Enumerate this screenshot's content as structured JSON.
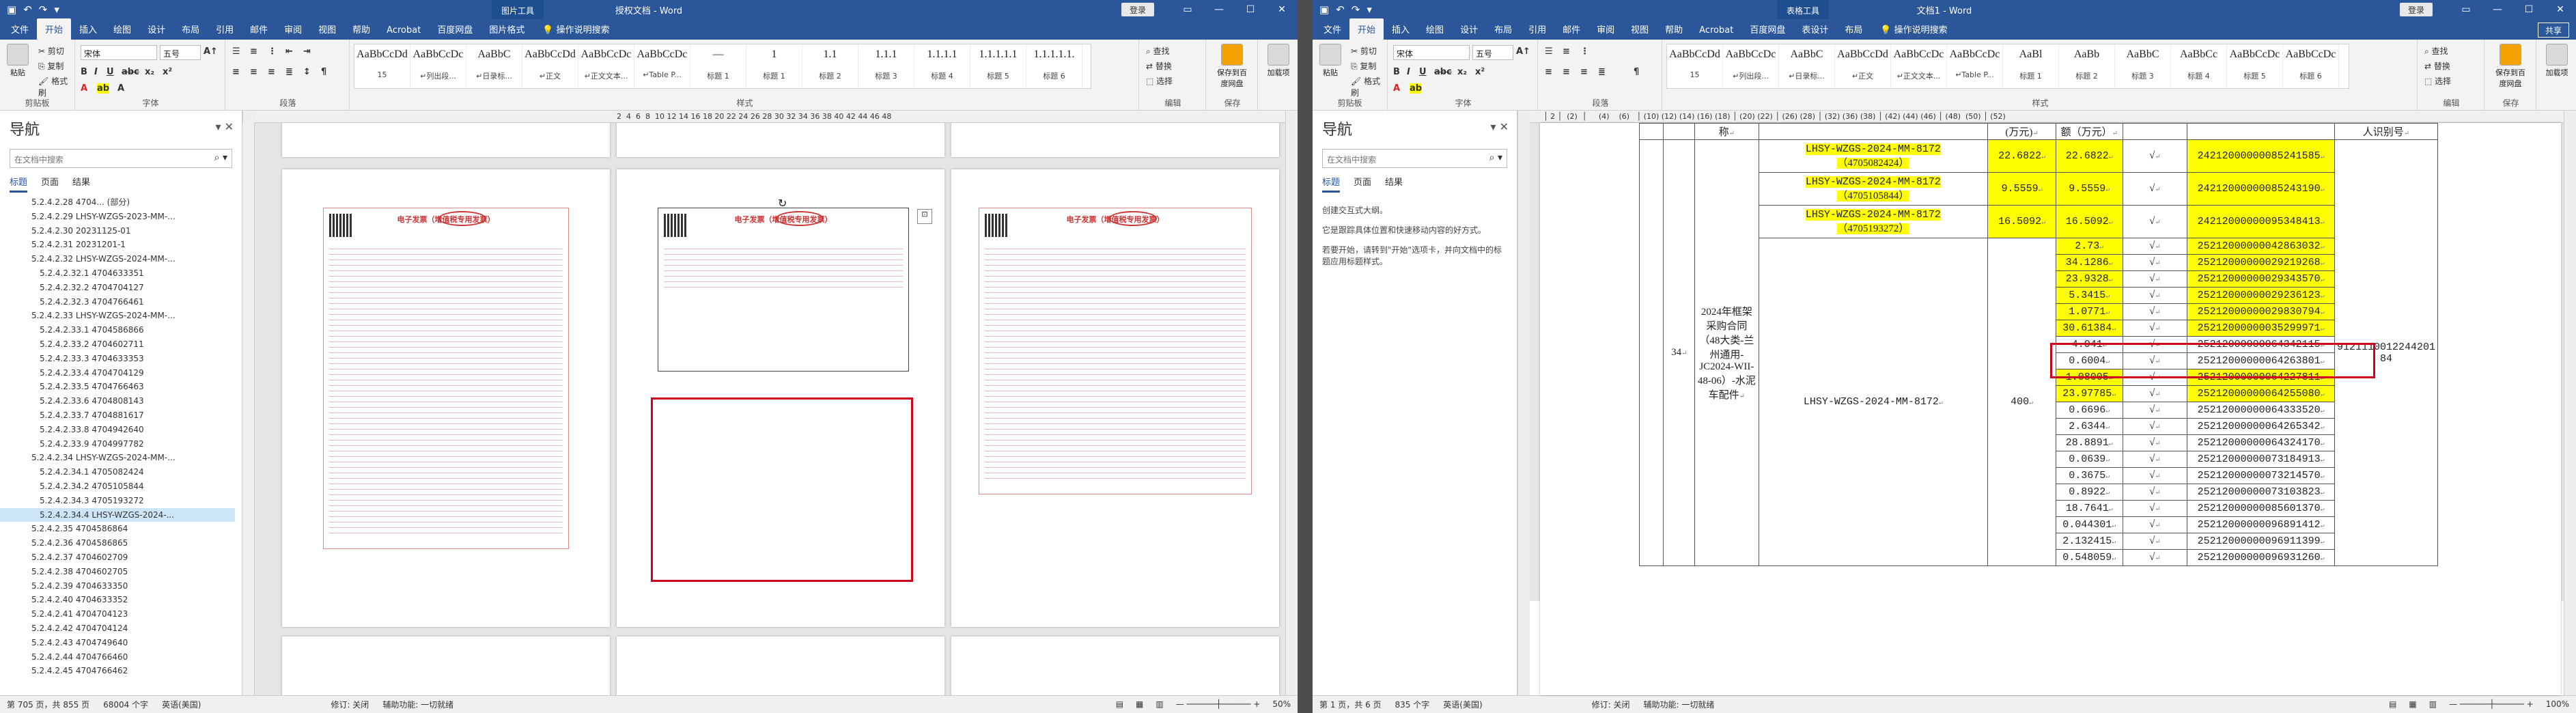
{
  "left_window": {
    "context_label": "图片工具",
    "title": "授权文档 - Word",
    "login": "登录",
    "tabs": [
      "文件",
      "开始",
      "插入",
      "绘图",
      "设计",
      "布局",
      "引用",
      "邮件",
      "审阅",
      "视图",
      "帮助",
      "Acrobat",
      "百度网盘",
      "图片格式"
    ],
    "active_tab": "开始",
    "tell_me": "操作说明搜索",
    "ribbon": {
      "clipboard": {
        "paste": "粘贴",
        "cut": "剪切",
        "copy": "复制",
        "format_painter": "格式刷",
        "label": "剪贴板"
      },
      "font": {
        "name": "宋体",
        "size": "五号",
        "label": "字体"
      },
      "paragraph": {
        "label": "段落"
      },
      "styles": {
        "label": "样式",
        "items": [
          {
            "preview": "AaBbCcDd",
            "name": "15"
          },
          {
            "preview": "AaBbCcDc",
            "name": "↵列出段..."
          },
          {
            "preview": "AaBbC",
            "name": "↵日录标..."
          },
          {
            "preview": "AaBbCcDd",
            "name": "↵正文"
          },
          {
            "preview": "AaBbCcDc",
            "name": "↵正文文本..."
          },
          {
            "preview": "AaBbCcDc",
            "name": "↵Table P..."
          },
          {
            "preview": "—",
            "name": "标题 1"
          },
          {
            "preview": "1",
            "name": "标题 1"
          },
          {
            "preview": "1.1",
            "name": "标题 2"
          },
          {
            "preview": "1.1.1",
            "name": "标题 3"
          },
          {
            "preview": "1.1.1.1",
            "name": "标题 4"
          },
          {
            "preview": "1.1.1.1.1",
            "name": "标题 5"
          },
          {
            "preview": "1.1.1.1.1.",
            "name": "标题 6"
          }
        ]
      },
      "editing": {
        "find": "查找",
        "replace": "替换",
        "select": "选择",
        "label": "编辑"
      },
      "save_baidu": "保存到百度网盘",
      "addins": "加载项",
      "save_group": "保存"
    },
    "nav": {
      "title": "导航",
      "search_placeholder": "在文档中搜索",
      "tabs": [
        "标题",
        "页面",
        "结果"
      ],
      "items": [
        "5.2.4.2.28 4704... (部分)",
        "5.2.4.2.29 LHSY-WZGS-2023-MM-...",
        "5.2.4.2.30 20231125-01",
        "5.2.4.2.31 20231201-1",
        "5.2.4.2.32 LHSY-WZGS-2024-MM-...",
        "5.2.4.2.32.1 4704633351",
        "5.2.4.2.32.2 4704704127",
        "5.2.4.2.32.3 4704766461",
        "5.2.4.2.33 LHSY-WZGS-2024-MM-...",
        "5.2.4.2.33.1 4704586866",
        "5.2.4.2.33.2 4704602711",
        "5.2.4.2.33.3 4704633353",
        "5.2.4.2.33.4 4704704129",
        "5.2.4.2.33.5 4704766463",
        "5.2.4.2.33.6 4704808143",
        "5.2.4.2.33.7 4704881617",
        "5.2.4.2.33.8 4704942640",
        "5.2.4.2.33.9 4704997782",
        "5.2.4.2.34 LHSY-WZGS-2024-MM-...",
        "5.2.4.2.34.1 4705082424",
        "5.2.4.2.34.2 4705105844",
        "5.2.4.2.34.3 4705193272",
        "5.2.4.2.34.4 LHSY-WZGS-2024-...",
        "5.2.4.2.35 4704586864",
        "5.2.4.2.36 4704586865",
        "5.2.4.2.37 4704602709",
        "5.2.4.2.38 4704602705",
        "5.2.4.2.39 4704633350",
        "5.2.4.2.40 4704633352",
        "5.2.4.2.41 4704704123",
        "5.2.4.2.42 4704704124",
        "5.2.4.2.43 4704749640",
        "5.2.4.2.44 4704766460",
        "5.2.4.2.45 4704766462"
      ],
      "selected_index": 22
    },
    "invoice_title": "电子发票（增值税专用发票）",
    "status": {
      "page": "第 705 页，共 855 页",
      "words": "68004 个字",
      "lang": "英语(美国)",
      "track": "修订: 关闭",
      "access": "辅助功能: 一切就绪",
      "zoom": "50%"
    }
  },
  "right_window": {
    "context_label": "表格工具",
    "title": "文档1 - Word",
    "login": "登录",
    "tabs": [
      "文件",
      "开始",
      "插入",
      "绘图",
      "设计",
      "布局",
      "引用",
      "邮件",
      "审阅",
      "视图",
      "帮助",
      "Acrobat",
      "百度网盘",
      "表设计",
      "布局"
    ],
    "active_tab": "开始",
    "tell_me": "操作说明搜索",
    "share": "共享",
    "ribbon": {
      "clipboard": {
        "paste": "粘贴",
        "cut": "剪切",
        "copy": "复制",
        "format_painter": "格式刷",
        "label": "剪贴板"
      },
      "font": {
        "name": "宋体",
        "size": "五号",
        "label": "字体"
      },
      "paragraph": {
        "label": "段落"
      },
      "styles": {
        "label": "样式",
        "items": [
          {
            "preview": "AaBbCcDd",
            "name": "15"
          },
          {
            "preview": "AaBbCcDc",
            "name": "↵列出段..."
          },
          {
            "preview": "AaBbC",
            "name": "↵日录标..."
          },
          {
            "preview": "AaBbCcDd",
            "name": "↵正文"
          },
          {
            "preview": "AaBbCcDc",
            "name": "↵正文文本..."
          },
          {
            "preview": "AaBbCcDc",
            "name": "↵Table P..."
          },
          {
            "preview": "AaBl",
            "name": "标题 1"
          },
          {
            "preview": "AaBb",
            "name": "标题 2"
          },
          {
            "preview": "AaBbC",
            "name": "标题 3"
          },
          {
            "preview": "AaBbCc",
            "name": "标题 4"
          },
          {
            "preview": "AaBbCcDc",
            "name": "标题 5"
          },
          {
            "preview": "AaBbCcDc",
            "name": "标题 6"
          }
        ]
      },
      "editing": {
        "find": "查找",
        "replace": "替换",
        "select": "选择",
        "label": "编辑"
      },
      "save_baidu": "保存到百度网盘",
      "addins": "加载项",
      "save_group": "保存"
    },
    "nav": {
      "title": "导航",
      "search_placeholder": "在文档中搜索",
      "tabs": [
        "标题",
        "页面",
        "结果"
      ],
      "msg1": "创建交互式大纲。",
      "msg2": "它是跟踪具体位置和快速移动内容的好方式。",
      "msg3": "若要开始，请转到\"开始\"选项卡，并向文档中的标题应用标题样式。"
    },
    "table": {
      "header_cells": [
        "称",
        "(万元)",
        "额（万元）",
        "人识别号"
      ],
      "row_no": "34",
      "project": "2024年框架采购合同（48大类-兰州通用-JC2024-WII-48-06）-水泥车配件",
      "contract_top": [
        {
          "code": "LHSY-WZGS-2024-MM-8172",
          "sub": "（4705082424）",
          "amt": "22.6822",
          "tax": "22.6822",
          "inv": "24212000000085241585"
        },
        {
          "code": "LHSY-WZGS-2024-MM-8172",
          "sub": "（4705105844）",
          "amt": "9.5559",
          "tax": "9.5559",
          "inv": "24212000000085243190"
        },
        {
          "code": "LHSY-WZGS-2024-MM-8172",
          "sub": "（4705193272）",
          "amt": "16.5092",
          "tax": "16.5092",
          "inv": "24212000000095348413"
        }
      ],
      "contract_main": "LHSY-WZGS-2024-MM-8172",
      "contract_amount": "400",
      "taxpayer_id": "9121110012244201 84",
      "rows": [
        {
          "amt": "2.73",
          "inv": "25212000000042863032",
          "hl": true
        },
        {
          "amt": "34.1286",
          "inv": "25212000000029219268",
          "hl": true
        },
        {
          "amt": "23.9328",
          "inv": "25212000000029343570",
          "hl": true
        },
        {
          "amt": "5.3415",
          "inv": "25212000000029236123",
          "hl": true
        },
        {
          "amt": "1.0771",
          "inv": "25212000000029830794",
          "hl": true
        },
        {
          "amt": "30.61384",
          "inv": "25212000000035299971",
          "hl": true
        },
        {
          "amt": "4.041",
          "inv": "25212000000064342115",
          "hl": false
        },
        {
          "amt": "0.6004",
          "inv": "25212000000064263801",
          "hl": false
        },
        {
          "amt": "1.08005",
          "inv": "25212000000064227811",
          "hl": true
        },
        {
          "amt": "23.97785",
          "inv": "25212000000064255080",
          "hl": true
        },
        {
          "amt": "0.6696",
          "inv": "25212000000064333520",
          "hl": false
        },
        {
          "amt": "2.6344",
          "inv": "25212000000064265342",
          "hl": false
        },
        {
          "amt": "28.8891",
          "inv": "25212000000064324170",
          "hl": false
        },
        {
          "amt": "0.0639",
          "inv": "25212000000073184913",
          "hl": false
        },
        {
          "amt": "0.3675",
          "inv": "25212000000073214570",
          "hl": false
        },
        {
          "amt": "0.8922",
          "inv": "25212000000073103823",
          "hl": false
        },
        {
          "amt": "18.7641",
          "inv": "25212000000085601370",
          "hl": false
        },
        {
          "amt": "0.044301",
          "inv": "25212000000096891412",
          "hl": false
        },
        {
          "amt": "2.132415",
          "inv": "25212000000096911399",
          "hl": false
        },
        {
          "amt": "0.548059",
          "inv": "25212000000096931260",
          "hl": false
        }
      ],
      "check": "√"
    },
    "status": {
      "page": "第 1 页，共 6 页",
      "words": "835 个字",
      "lang": "英语(美国)",
      "track": "修订: 关闭",
      "access": "辅助功能: 一切就绪",
      "zoom": "100%"
    }
  }
}
